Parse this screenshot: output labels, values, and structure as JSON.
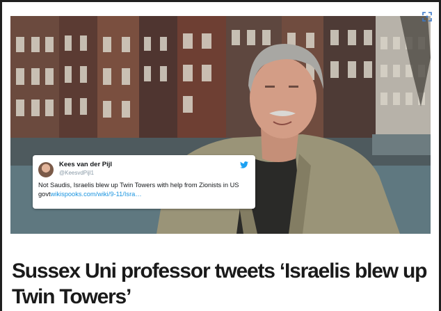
{
  "article": {
    "headline": "Sussex Uni professor tweets ‘Israelis blew up Twin Towers’"
  },
  "image": {
    "expand_icon": "expand-icon"
  },
  "tweet": {
    "author_name": "Kees van der Pijl",
    "handle": "@KeesvdPijl1",
    "text": "Not Saudis, Israelis blew up Twin Towers  with help from Zionists in US govt",
    "link_text": "wikispooks.com/wiki/9-11/Isra…",
    "brand_icon": "twitter-bird-icon",
    "link_color": "#1b95e0"
  }
}
